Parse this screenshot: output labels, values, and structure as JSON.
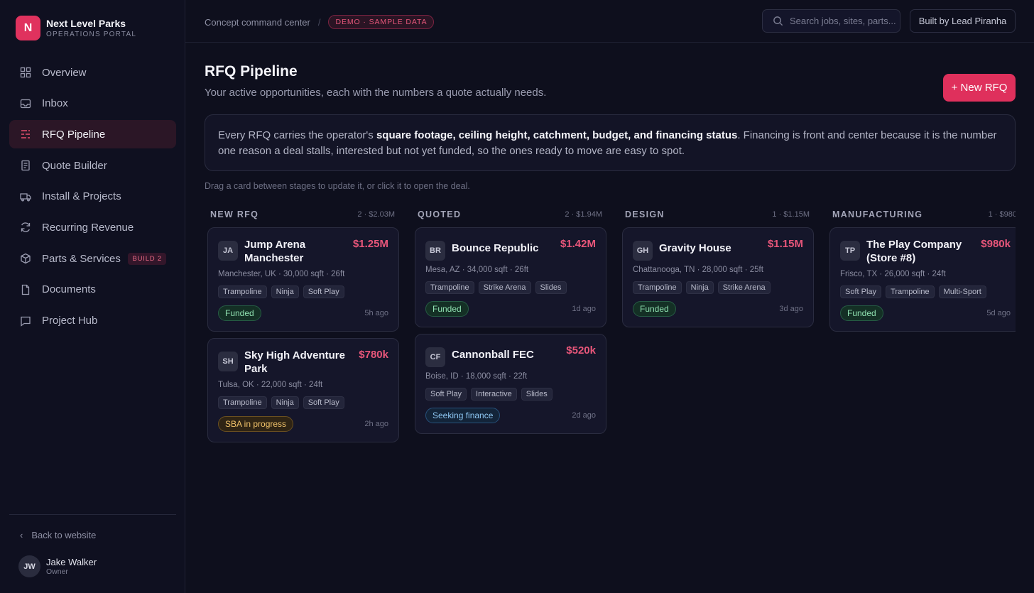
{
  "brand": {
    "logo_letter": "N",
    "name": "Next Level Parks",
    "subtitle": "OPERATIONS PORTAL",
    "accent": "#e0325e"
  },
  "sidebar": {
    "items": [
      {
        "label": "Overview",
        "icon": "grid-icon"
      },
      {
        "label": "Inbox",
        "icon": "inbox-icon"
      },
      {
        "label": "RFQ Pipeline",
        "icon": "pipeline-icon",
        "active": true
      },
      {
        "label": "Quote Builder",
        "icon": "document-list-icon"
      },
      {
        "label": "Install & Projects",
        "icon": "truck-icon"
      },
      {
        "label": "Recurring Revenue",
        "icon": "refresh-icon"
      },
      {
        "label": "Parts & Services",
        "icon": "box-icon",
        "badge": "BUILD 2"
      },
      {
        "label": "Documents",
        "icon": "file-icon"
      },
      {
        "label": "Project Hub",
        "icon": "chat-icon"
      }
    ],
    "back_link": "Back to website",
    "user": {
      "initials": "JW",
      "name": "Jake Walker",
      "role": "Owner"
    }
  },
  "topbar": {
    "breadcrumb": "Concept command center",
    "separator": "/",
    "demo_badge": "DEMO · SAMPLE DATA",
    "search_placeholder": "Search jobs, sites, parts...",
    "built_by": "Built by Lead Piranha"
  },
  "main": {
    "title": "RFQ Pipeline",
    "subtitle": "Your active opportunities, each with the numbers a quote actually needs.",
    "new_button": "+ New RFQ",
    "info_prefix": "Every RFQ carries the operator's ",
    "info_bold": "square footage, ceiling height, catchment, budget, and financing status",
    "info_suffix": ". Financing is front and center because it is the number one reason a deal stalls, interested but not yet funded, so the ones ready to move are easy to spot.",
    "hint": "Drag a card between stages to update it, or click it to open the deal."
  },
  "columns": [
    {
      "title": "NEW RFQ",
      "meta": "2 · $2.03M",
      "cards": [
        {
          "initials": "JA",
          "name": "Jump Arena Manchester",
          "value": "$1.25M",
          "location": "Manchester, UK · 30,000 sqft · 26ft",
          "tags": [
            "Trampoline",
            "Ninja",
            "Soft Play"
          ],
          "status": "Funded",
          "status_kind": "funded",
          "ago": "5h ago"
        },
        {
          "initials": "SH",
          "name": "Sky High Adventure Park",
          "value": "$780k",
          "location": "Tulsa, OK · 22,000 sqft · 24ft",
          "tags": [
            "Trampoline",
            "Ninja",
            "Soft Play"
          ],
          "status": "SBA in progress",
          "status_kind": "sba",
          "ago": "2h ago"
        }
      ]
    },
    {
      "title": "QUOTED",
      "meta": "2 · $1.94M",
      "cards": [
        {
          "initials": "BR",
          "name": "Bounce Republic",
          "value": "$1.42M",
          "location": "Mesa, AZ · 34,000 sqft · 26ft",
          "tags": [
            "Trampoline",
            "Strike Arena",
            "Slides"
          ],
          "status": "Funded",
          "status_kind": "funded",
          "ago": "1d ago"
        },
        {
          "initials": "CF",
          "name": "Cannonball FEC",
          "value": "$520k",
          "location": "Boise, ID · 18,000 sqft · 22ft",
          "tags": [
            "Soft Play",
            "Interactive",
            "Slides"
          ],
          "status": "Seeking finance",
          "status_kind": "seeking",
          "ago": "2d ago"
        }
      ]
    },
    {
      "title": "DESIGN",
      "meta": "1 · $1.15M",
      "cards": [
        {
          "initials": "GH",
          "name": "Gravity House",
          "value": "$1.15M",
          "location": "Chattanooga, TN · 28,000 sqft · 25ft",
          "tags": [
            "Trampoline",
            "Ninja",
            "Strike Arena"
          ],
          "status": "Funded",
          "status_kind": "funded",
          "ago": "3d ago"
        }
      ]
    },
    {
      "title": "MANUFACTURING",
      "meta": "1 · $980",
      "cards": [
        {
          "initials": "TP",
          "name": "The Play Company (Store #8)",
          "value": "$980k",
          "location": "Frisco, TX · 26,000 sqft · 24ft",
          "tags": [
            "Soft Play",
            "Trampoline",
            "Multi-Sport"
          ],
          "status": "Funded",
          "status_kind": "funded",
          "ago": "5d ago"
        }
      ]
    }
  ]
}
